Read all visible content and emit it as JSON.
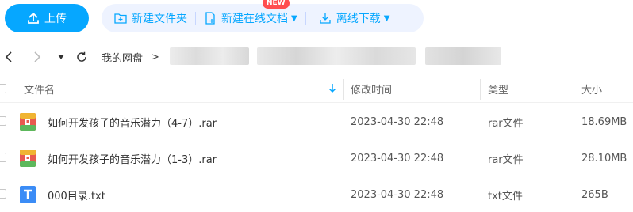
{
  "toolbar": {
    "upload_label": "上传",
    "new_folder_label": "新建文件夹",
    "new_online_doc_label": "新建在线文档",
    "new_badge": "NEW",
    "offline_download_label": "离线下载"
  },
  "breadcrumb": {
    "root": "我的网盘",
    "separator": ">"
  },
  "table": {
    "headers": {
      "name": "文件名",
      "modified": "修改时间",
      "type": "类型",
      "size": "大小"
    },
    "rows": [
      {
        "name": "如何开发孩子的音乐潜力（4-7）.rar",
        "modified": "2023-04-30 22:48",
        "type": "rar文件",
        "size": "18.69MB",
        "icon": "archive-icon"
      },
      {
        "name": "如何开发孩子的音乐潜力（1-3）.rar",
        "modified": "2023-04-30 22:48",
        "type": "rar文件",
        "size": "28.10MB",
        "icon": "archive-icon"
      },
      {
        "name": "000目录.txt",
        "modified": "2023-04-30 22:48",
        "type": "txt文件",
        "size": "265B",
        "icon": "text-file-icon"
      }
    ]
  },
  "colors": {
    "accent": "#06a7ff",
    "toolbar_bg": "#eef3ff",
    "badge": "#ff4d4f",
    "archive_icon": "#e85a4f",
    "text_icon": "#3b8cf6"
  }
}
